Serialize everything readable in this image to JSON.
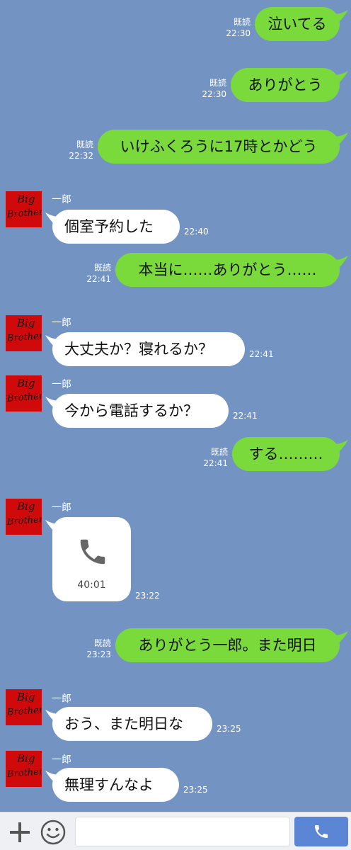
{
  "read_label": "既読",
  "contact": {
    "name": "一郎",
    "avatar_text": [
      "Big",
      "Brother"
    ]
  },
  "messages": [
    {
      "dir": "out",
      "text": "泣いてる",
      "time": "22:30",
      "read": true
    },
    {
      "dir": "out",
      "text": "ありがとう",
      "time": "22:30",
      "read": true
    },
    {
      "dir": "out",
      "text": "いけふくろうに17時とかどう",
      "time": "22:32",
      "read": true
    },
    {
      "dir": "in",
      "text": "個室予約した",
      "time": "22:40"
    },
    {
      "dir": "out",
      "text": "本当に……ありがとう……",
      "time": "22:41",
      "read": true
    },
    {
      "dir": "in",
      "text": "大丈夫か？寝れるか？",
      "time": "22:41"
    },
    {
      "dir": "in",
      "text": "今から電話するか？",
      "time": "22:41"
    },
    {
      "dir": "out",
      "text": "する………",
      "time": "22:41",
      "read": true
    },
    {
      "dir": "in",
      "type": "call",
      "duration": "40:01",
      "time": "23:22"
    },
    {
      "dir": "out",
      "text": "ありがとう一郎。また明日",
      "time": "23:23",
      "read": true
    },
    {
      "dir": "in",
      "text": "おう、また明日な",
      "time": "23:25"
    },
    {
      "dir": "in",
      "text": "無理すんなよ",
      "time": "23:25"
    }
  ],
  "bottom_bar": {
    "icons": [
      "plus-icon",
      "emoji-icon",
      "phone-icon"
    ],
    "input_value": "",
    "input_placeholder": ""
  },
  "colors": {
    "background": "#7394c3",
    "outgoing_bubble": "#7ada3c",
    "incoming_bubble": "#ffffff",
    "call_button": "#5b86d6",
    "avatar": "#d00a0a"
  }
}
